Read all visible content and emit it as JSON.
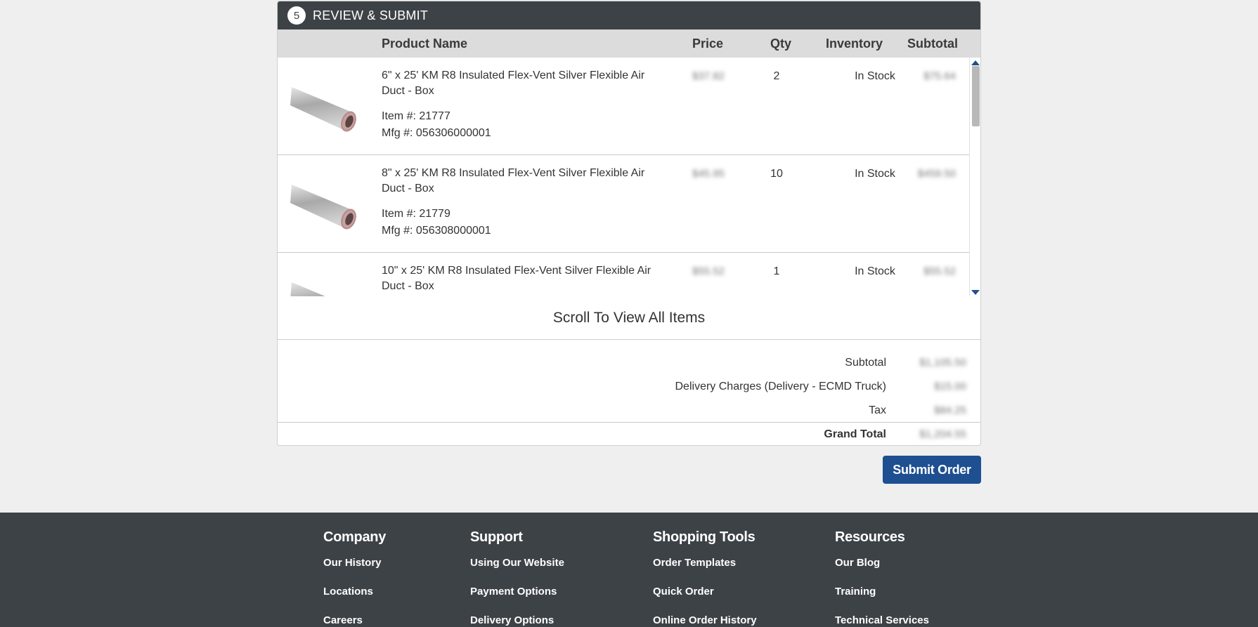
{
  "review": {
    "step_number": "5",
    "title": "REVIEW & SUBMIT",
    "columns": {
      "product_name": "Product Name",
      "price": "Price",
      "qty": "Qty",
      "inventory": "Inventory",
      "subtotal": "Subtotal"
    },
    "items": [
      {
        "name": "6\" x 25' KM R8 Insulated Flex-Vent Silver Flexible Air Duct - Box",
        "item_no": "Item #: 21777",
        "mfg_no": "Mfg #: 056306000001",
        "price": "$37.82",
        "qty": "2",
        "inventory": "In Stock",
        "subtotal": "$75.64"
      },
      {
        "name": "8\" x 25' KM R8 Insulated Flex-Vent Silver Flexible Air Duct - Box",
        "item_no": "Item #: 21779",
        "mfg_no": "Mfg #: 056308000001",
        "price": "$45.95",
        "qty": "10",
        "inventory": "In Stock",
        "subtotal": "$459.50"
      },
      {
        "name": "10\" x 25' KM R8 Insulated Flex-Vent Silver Flexible Air Duct - Box",
        "item_no": "",
        "mfg_no": "",
        "price": "$55.52",
        "qty": "1",
        "inventory": "In Stock",
        "subtotal": "$55.52"
      }
    ],
    "scroll_hint": "Scroll To View All Items",
    "totals": {
      "subtotal_label": "Subtotal",
      "subtotal_value": "$1,105.50",
      "delivery_label": "Delivery Charges (Delivery - ECMD Truck)",
      "delivery_value": "$15.00",
      "tax_label": "Tax",
      "tax_value": "$84.25",
      "grand_label": "Grand Total",
      "grand_value": "$1,204.55"
    }
  },
  "submit_button": "Submit Order",
  "footer": {
    "columns": [
      {
        "heading": "Company",
        "links": [
          "Our History",
          "Locations",
          "Careers"
        ]
      },
      {
        "heading": "Support",
        "links": [
          "Using Our Website",
          "Payment Options",
          "Delivery Options"
        ]
      },
      {
        "heading": "Shopping Tools",
        "links": [
          "Order Templates",
          "Quick Order",
          "Online Order History"
        ]
      },
      {
        "heading": "Resources",
        "links": [
          "Our Blog",
          "Training",
          "Technical Services"
        ]
      }
    ]
  },
  "colors": {
    "header_bg": "#3d4247",
    "column_header_bg": "#dcdcdc",
    "button_bg": "#1d4f91",
    "page_bg": "#efefef"
  }
}
